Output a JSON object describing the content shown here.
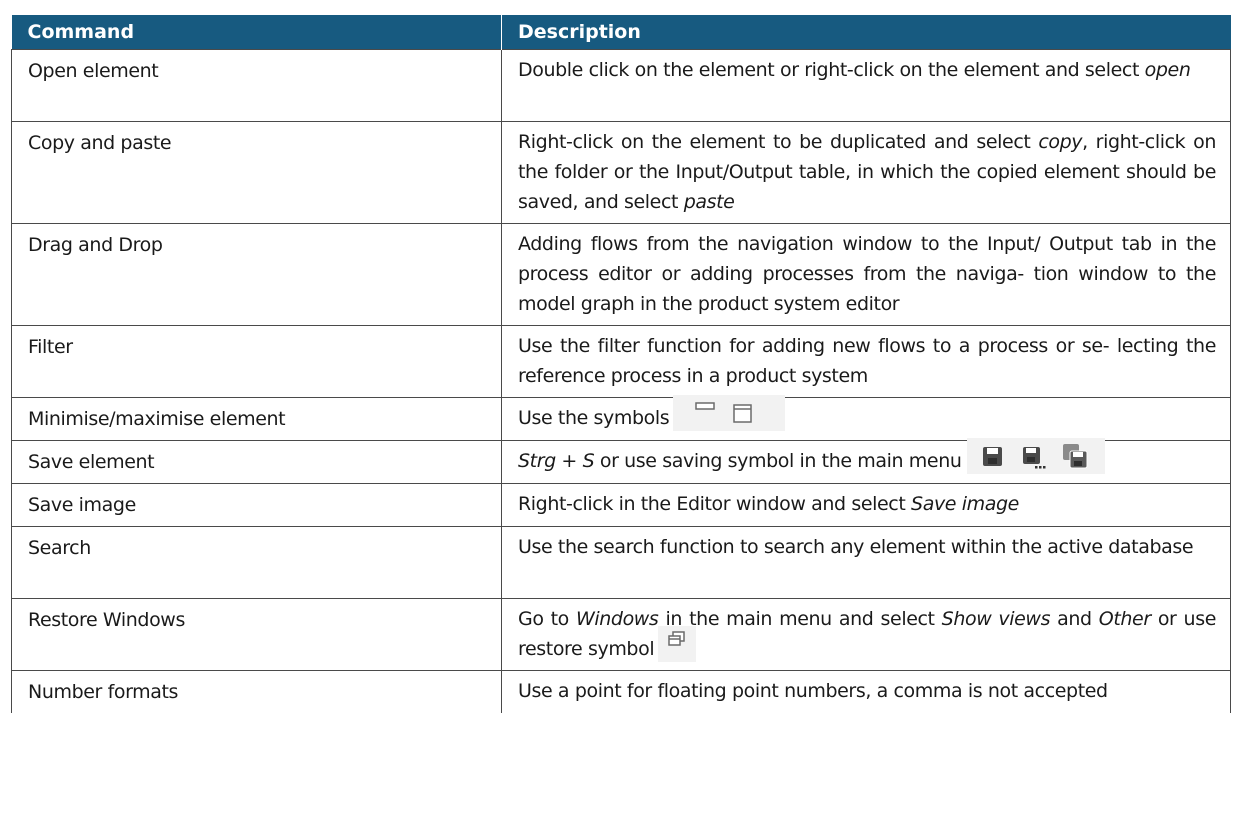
{
  "header": {
    "command": "Command",
    "description": "Description"
  },
  "rows": [
    {
      "command": "Open element",
      "desc": [
        "Double click on the element or right-click on the element and select ",
        "open"
      ]
    },
    {
      "command": "Copy and paste",
      "desc": [
        "Right-click on the element to be duplicated and select ",
        "copy",
        ", right-click on the folder or the Input/Output table, in which the copied element should be saved, and select ",
        "paste"
      ]
    },
    {
      "command": "Drag and Drop",
      "desc": [
        "Adding flows from the navigation window to the Input/ Output tab in the process editor or adding processes from the naviga- tion window to the model graph in the product system editor"
      ]
    },
    {
      "command": "Filter",
      "desc": [
        "Use the filter function for adding new flows to a process or se- lecting the reference process in a product system"
      ]
    },
    {
      "command": "Minimise/maximise element",
      "desc": [
        "Use the symbols"
      ]
    },
    {
      "command": "Save element",
      "desc": [
        "Strg + S",
        " or use saving symbol in the main menu"
      ]
    },
    {
      "command": "Save image",
      "desc": [
        "Right-click in the Editor window and select ",
        "Save image"
      ]
    },
    {
      "command": "Search",
      "desc": [
        "Use the search function to search any element within the active database"
      ]
    },
    {
      "command": "Restore Windows",
      "desc": [
        "Go to ",
        "Windows",
        " in the main menu and select ",
        "Show views",
        " and ",
        "Other",
        " or use restore symbol"
      ]
    },
    {
      "command": "Number formats",
      "desc": [
        "Use a point for floating point numbers, a comma is not accepted"
      ]
    }
  ],
  "icons": {
    "minimise": "minimise-icon",
    "maximise": "maximise-icon",
    "save": "save-icon",
    "save_as": "save-as-icon",
    "save_all": "save-all-icon",
    "restore": "restore-icon"
  },
  "colors": {
    "header_bg": "#175a80",
    "header_text": "#ffffff",
    "border": "#4a4a4a"
  }
}
